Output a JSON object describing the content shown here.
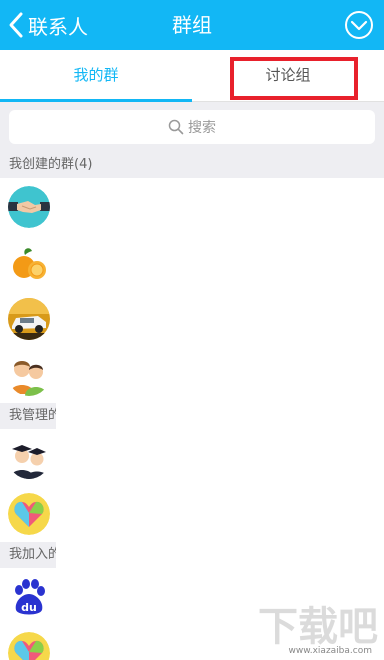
{
  "header": {
    "back_label": "联系人",
    "title": "群组"
  },
  "tabs": [
    {
      "label": "我的群",
      "active": true
    },
    {
      "label": "讨论组",
      "active": false
    }
  ],
  "search": {
    "placeholder": "搜索"
  },
  "sections": [
    {
      "title": "我创建的群(4)",
      "avatars": [
        "handshake-avatar",
        "oranges-avatar",
        "car-avatar",
        "people-avatar"
      ]
    },
    {
      "title": "我管理的",
      "avatars": [
        "graduates-avatar",
        "heart-avatar"
      ]
    },
    {
      "title": "我加入的",
      "avatars": [
        "baidu-paw-avatar",
        "heart-avatar"
      ]
    }
  ],
  "colors": {
    "brand": "#12b7f5",
    "highlight": "#e8212c",
    "section_bg": "#eeeef2"
  },
  "watermark": {
    "text": "www.xiazaiba.com"
  }
}
